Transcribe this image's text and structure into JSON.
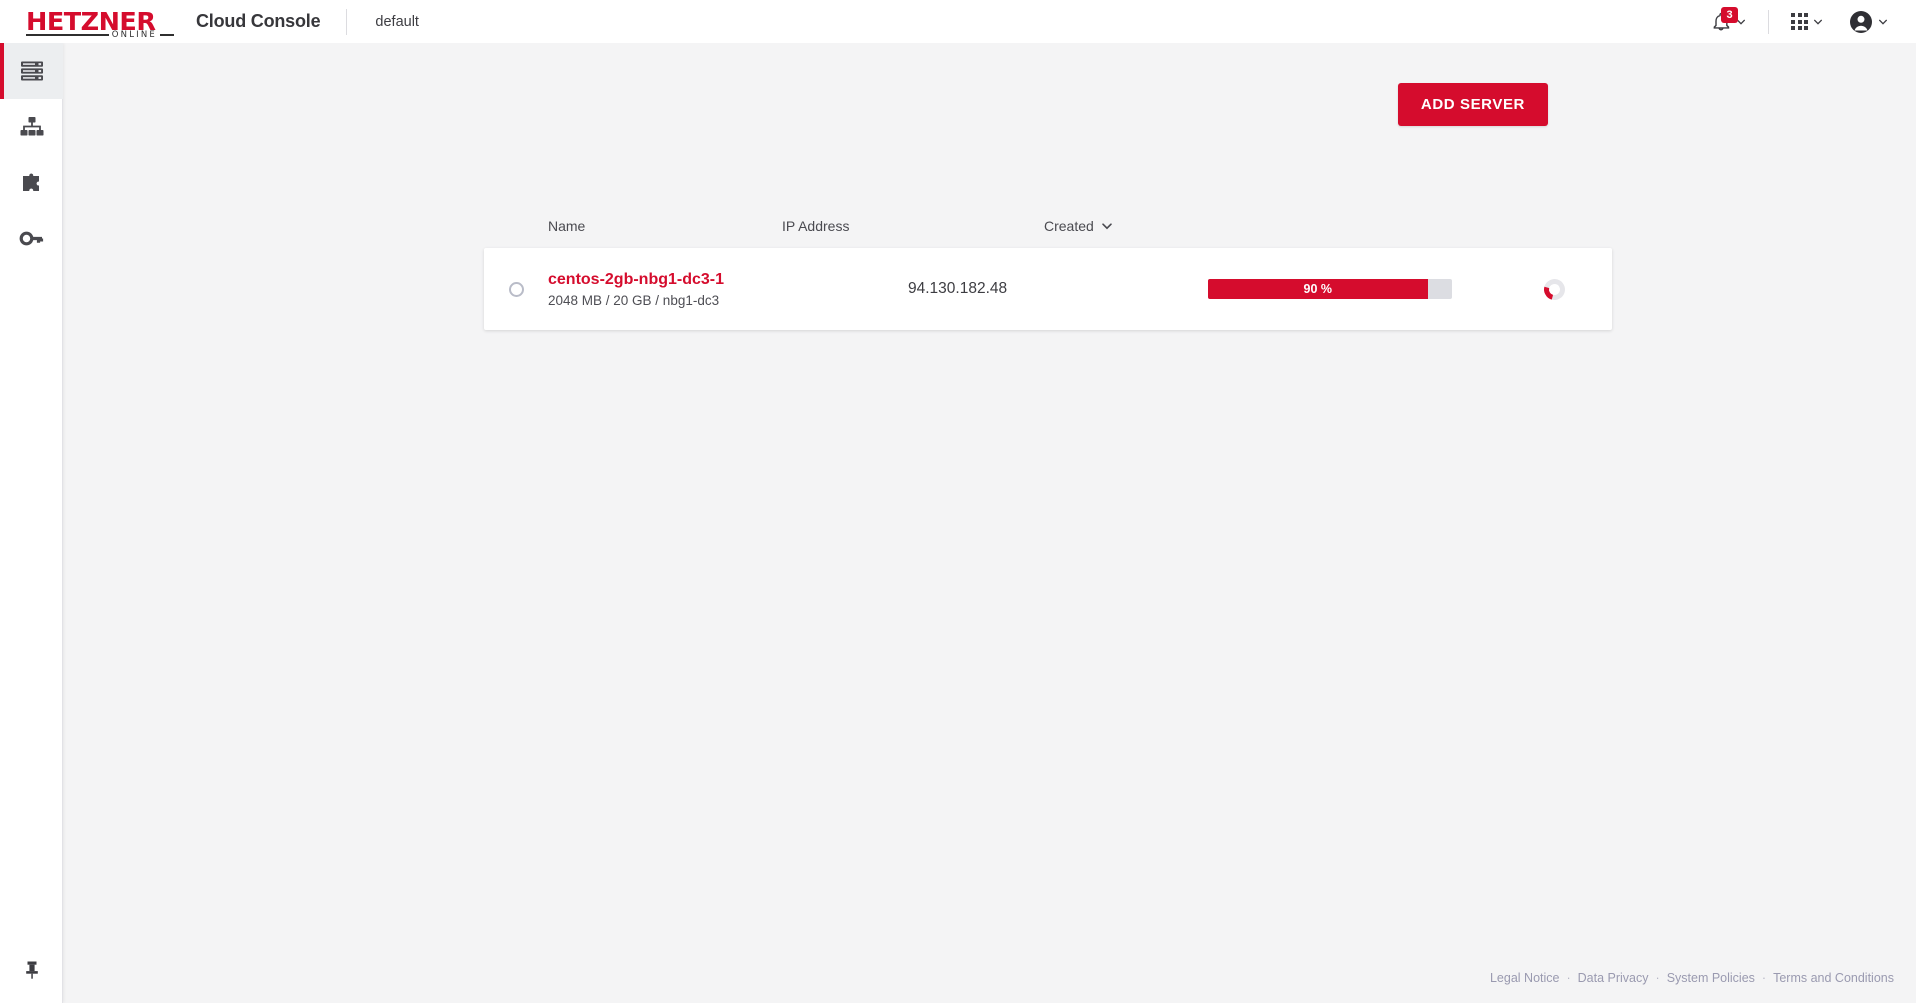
{
  "header": {
    "logo_text": "HETZNER",
    "logo_sub": "ONLINE",
    "app_title": "Cloud Console",
    "project_name": "default",
    "notifications": {
      "icon": "bell-icon",
      "badge_count": "3",
      "chevron": "chevron-down-icon"
    },
    "apps": {
      "icon": "grid-apps-icon",
      "chevron": "chevron-down-icon"
    },
    "account": {
      "icon": "account-avatar-icon",
      "chevron": "chevron-down-icon"
    }
  },
  "sidebar": {
    "items": [
      {
        "name": "servers",
        "icon": "servers-icon",
        "active": true
      },
      {
        "name": "networks",
        "icon": "network-sitemap-icon",
        "active": false
      },
      {
        "name": "add-ons",
        "icon": "puzzle-piece-icon",
        "active": false
      },
      {
        "name": "security",
        "icon": "key-icon",
        "active": false
      }
    ],
    "pin": {
      "icon": "pin-icon"
    }
  },
  "toolbar": {
    "add_server_label": "ADD SERVER"
  },
  "table": {
    "columns": {
      "name": "Name",
      "ip": "IP Address",
      "created": "Created",
      "created_sort_icon": "chevron-down-icon"
    },
    "rows": [
      {
        "status_icon": "status-circle-icon",
        "name": "centos-2gb-nbg1-dc3-1",
        "meta": "2048 MB / 20 GB / nbg1-dc3",
        "ip": "94.130.182.48",
        "progress_label": "90 %",
        "progress_percent": 90,
        "activity_icon": "loading-spinner-icon"
      }
    ]
  },
  "footer": {
    "links": [
      "Legal Notice",
      "Data Privacy",
      "System Policies",
      "Terms and Conditions"
    ],
    "separator": "·"
  },
  "colors": {
    "brand_red": "#d50c2d",
    "page_bg": "#f4f4f5",
    "card_bg": "#ffffff",
    "sidebar_active_bg": "#eceef0",
    "footer_link": "#9a9ab0"
  }
}
